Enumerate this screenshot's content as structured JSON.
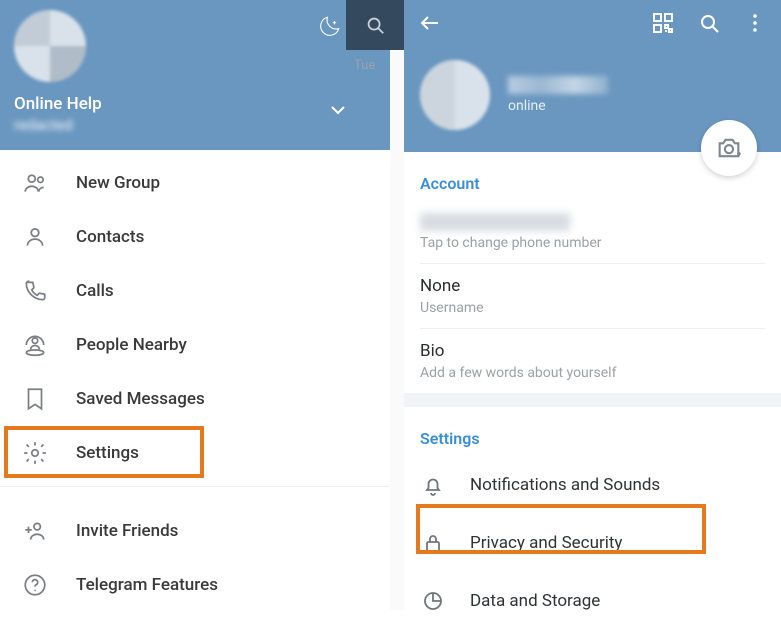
{
  "left": {
    "title": "Online Help",
    "subtitle": "redacted",
    "menu": [
      {
        "label": "New Group"
      },
      {
        "label": "Contacts"
      },
      {
        "label": "Calls"
      },
      {
        "label": "People Nearby"
      },
      {
        "label": "Saved Messages"
      },
      {
        "label": "Settings"
      },
      {
        "label": "Invite Friends"
      },
      {
        "label": "Telegram Features"
      }
    ]
  },
  "mid": {
    "day": "Tue"
  },
  "right": {
    "profile": {
      "status": "online"
    },
    "account": {
      "title": "Account",
      "phone_hint": "Tap to change phone number",
      "username_value": "None",
      "username_label": "Username",
      "bio_value": "Bio",
      "bio_hint": "Add a few words about yourself"
    },
    "settings": {
      "title": "Settings",
      "items": [
        {
          "label": "Notifications and Sounds"
        },
        {
          "label": "Privacy and Security"
        },
        {
          "label": "Data and Storage"
        }
      ]
    }
  }
}
